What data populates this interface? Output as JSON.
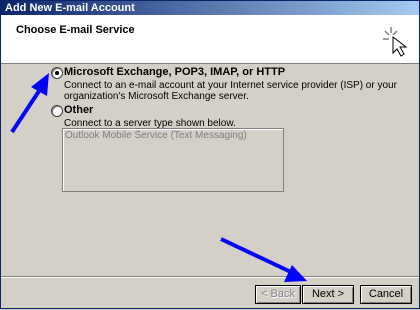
{
  "window": {
    "title": "Add New E-mail Account"
  },
  "header": {
    "heading": "Choose E-mail Service"
  },
  "options": [
    {
      "label": "Microsoft Exchange, POP3, IMAP, or HTTP",
      "description_line1": "Connect to an e-mail account at your Internet service provider (ISP) or your",
      "description_line2": "organization's Microsoft Exchange server.",
      "selected": true
    },
    {
      "label": "Other",
      "description_line1": "Connect to a server type shown below.",
      "selected": false
    }
  ],
  "server_list": {
    "items": [
      "Outlook Mobile Service (Text Messaging)"
    ]
  },
  "buttons": {
    "back": "< Back",
    "next": "Next >",
    "cancel": "Cancel"
  },
  "colors": {
    "title_bar": "#0a246a",
    "arrow": "#0000ff",
    "dialog_bg": "#d4d0c8"
  }
}
